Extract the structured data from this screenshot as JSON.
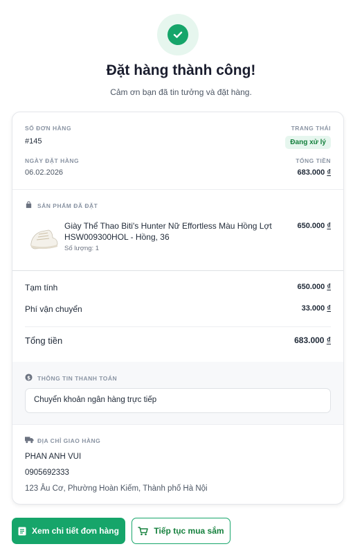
{
  "header": {
    "title": "Đặt hàng thành công!",
    "subtitle": "Cảm ơn bạn đã tin tưởng và đặt hàng."
  },
  "order": {
    "number_label": "SỐ ĐƠN HÀNG",
    "number": "#145",
    "status_label": "TRANG THÁI",
    "status": "Đang xử lý",
    "date_label": "NGÀY ĐẶT HÀNG",
    "date": "06.02.2026",
    "total_label": "TỔNG TIỀN",
    "total_amount": "683.000",
    "currency": "₫"
  },
  "products": {
    "section_title": "SẢN PHẨM ĐÃ ĐẶT",
    "items": [
      {
        "name": "Giày Thể Thao Biti's Hunter Nữ Effortless Màu Hồng Lợt HSW009300HOL - Hồng, 36",
        "quantity": "Số lượng: 1",
        "price": "650.000"
      }
    ]
  },
  "summary": {
    "subtotal_label": "Tạm tính",
    "subtotal": "650.000",
    "shipping_label": "Phí vận chuyển",
    "shipping": "33.000",
    "total_label": "Tổng tiền",
    "total": "683.000"
  },
  "payment": {
    "section_title": "THÔNG TIN THANH TOÁN",
    "method": "Chuyển khoản ngân hàng trực tiếp"
  },
  "shipping_address": {
    "section_title": "ĐỊA CHỈ GIAO HÀNG",
    "name": "PHAN ANH VUI",
    "phone": "0905692333",
    "address": "123 Âu Cơ, Phường Hoàn Kiếm, Thành phố Hà Nội"
  },
  "actions": {
    "view_details": "Xem chi tiết đơn hàng",
    "continue_shopping": "Tiếp tục mua sắm"
  },
  "colors": {
    "accent": "#16a56a",
    "accent_light": "#e6f6ee",
    "status_text": "#15803d"
  },
  "icons": {
    "success": "check-circle-icon",
    "bag": "shopping-bag-icon",
    "payment": "dollar-circle-icon",
    "truck": "truck-icon",
    "document": "document-icon",
    "cart": "cart-icon"
  }
}
